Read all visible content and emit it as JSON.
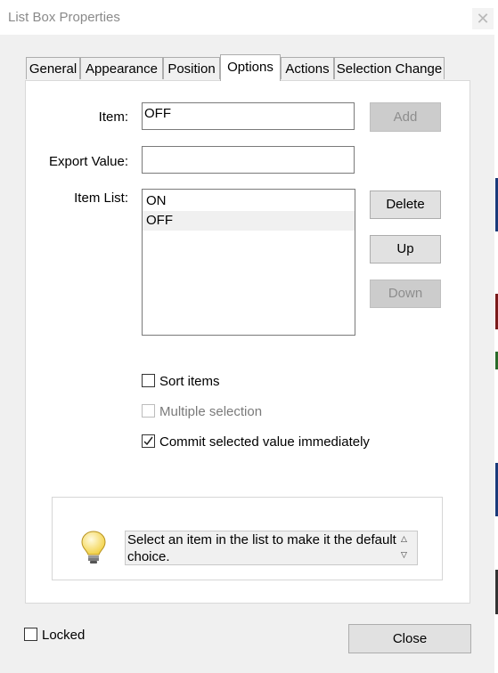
{
  "window": {
    "title": "List Box Properties",
    "close_symbol": "✕"
  },
  "tabs": [
    {
      "label": "General"
    },
    {
      "label": "Appearance"
    },
    {
      "label": "Position"
    },
    {
      "label": "Options"
    },
    {
      "label": "Actions"
    },
    {
      "label": "Selection Change"
    }
  ],
  "active_tab": "Options",
  "options": {
    "item_label": "Item:",
    "item_value": "OFF",
    "add_label": "Add",
    "export_label": "Export Value:",
    "export_value": "",
    "item_list_label": "Item List:",
    "items": [
      "ON",
      "OFF"
    ],
    "selected_item": "OFF",
    "delete_label": "Delete",
    "up_label": "Up",
    "down_label": "Down",
    "sort_label": "Sort items",
    "sort_checked": false,
    "multiple_label": "Multiple selection",
    "multiple_checked": false,
    "multiple_enabled": false,
    "commit_label": "Commit selected value immediately",
    "commit_checked": true
  },
  "hint": {
    "icon": "lightbulb-icon",
    "text": "Select an item in the list to make it the default choice."
  },
  "footer": {
    "locked_label": "Locked",
    "locked_checked": false,
    "close_label": "Close"
  }
}
